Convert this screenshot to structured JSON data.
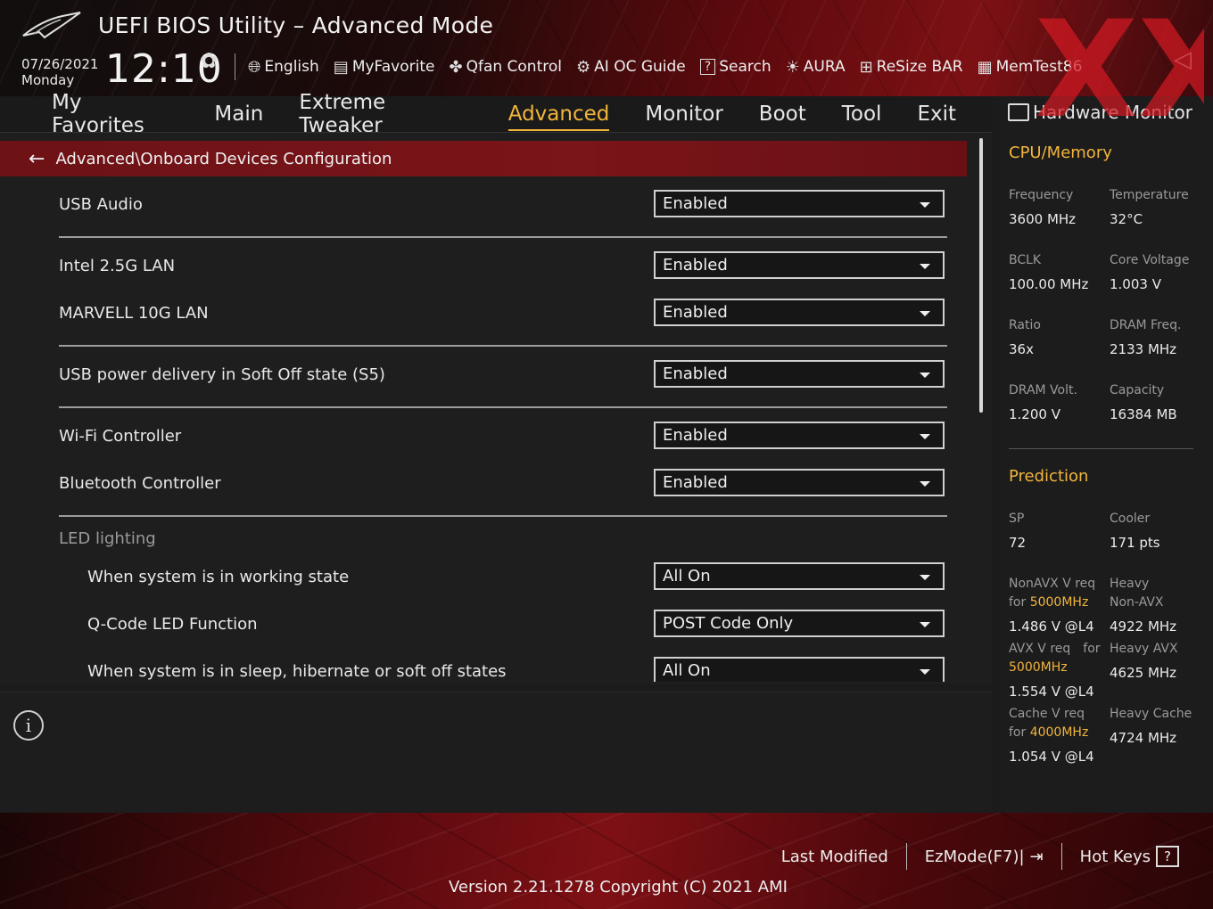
{
  "header": {
    "title": "UEFI BIOS Utility – Advanced Mode",
    "date": "07/26/2021",
    "day": "Monday",
    "time": "12:10",
    "brand_watermark": "XX",
    "tools": [
      {
        "icon": "globe-icon",
        "label": "English"
      },
      {
        "icon": "favorites-icon",
        "label": "MyFavorite"
      },
      {
        "icon": "fan-icon",
        "label": "Qfan Control"
      },
      {
        "icon": "ai-chip-icon",
        "label": "AI OC Guide"
      },
      {
        "icon": "question-box-icon",
        "label": "Search"
      },
      {
        "icon": "aura-light-icon",
        "label": "AURA"
      },
      {
        "icon": "resize-bar-icon",
        "label": "ReSize BAR"
      },
      {
        "icon": "memory-icon",
        "label": "MemTest86"
      }
    ]
  },
  "nav": {
    "tabs": [
      {
        "label": "My Favorites",
        "active": false
      },
      {
        "label": "Main",
        "active": false
      },
      {
        "label": "Extreme Tweaker",
        "active": false
      },
      {
        "label": "Advanced",
        "active": true
      },
      {
        "label": "Monitor",
        "active": false
      },
      {
        "label": "Boot",
        "active": false
      },
      {
        "label": "Tool",
        "active": false
      },
      {
        "label": "Exit",
        "active": false
      }
    ]
  },
  "main": {
    "breadcrumb": "Advanced\\Onboard Devices Configuration",
    "settings": [
      {
        "label": "USB Audio",
        "value": "Enabled"
      },
      {
        "label": "Intel 2.5G LAN",
        "value": "Enabled"
      },
      {
        "label": "MARVELL 10G LAN",
        "value": "Enabled"
      },
      {
        "label": "USB power delivery in Soft Off state (S5)",
        "value": "Enabled"
      },
      {
        "label": "Wi-Fi Controller",
        "value": "Enabled"
      },
      {
        "label": "Bluetooth Controller",
        "value": "Enabled"
      },
      {
        "label": "LED lighting"
      },
      {
        "label": "When system is in working state",
        "value": "All On"
      },
      {
        "label": "Q-Code LED Function",
        "value": "POST Code Only"
      },
      {
        "label": "When system is in sleep, hibernate or soft off states",
        "value": "All On"
      }
    ]
  },
  "hw_monitor": {
    "title": "Hardware Monitor",
    "cpu_memory": {
      "heading": "CPU/Memory",
      "frequency_label": "Frequency",
      "frequency": "3600 MHz",
      "temperature_label": "Temperature",
      "temperature": "32°C",
      "bclk_label": "BCLK",
      "bclk": "100.00 MHz",
      "core_voltage_label": "Core Voltage",
      "core_voltage": "1.003 V",
      "ratio_label": "Ratio",
      "ratio": "36x",
      "dram_freq_label": "DRAM Freq.",
      "dram_freq": "2133 MHz",
      "dram_volt_label": "DRAM Volt.",
      "dram_volt": "1.200 V",
      "capacity_label": "Capacity",
      "capacity": "16384 MB"
    },
    "prediction": {
      "heading": "Prediction",
      "sp_label": "SP",
      "sp": "72",
      "cooler_label": "Cooler",
      "cooler": "171 pts",
      "nonavx_label_1": "NonAVX V req",
      "nonavx_label_for": "for ",
      "nonavx_freq": "5000MHz",
      "nonavx_v": "1.486 V @L4",
      "heavy_nonavx_label_1": "Heavy",
      "heavy_nonavx_label_2": "Non-AVX",
      "heavy_nonavx": "4922 MHz",
      "avx_label_1": "AVX V req",
      "avx_label_for": "for",
      "avx_freq": "5000MHz",
      "avx_v": "1.554 V @L4",
      "heavy_avx_label": "Heavy AVX",
      "heavy_avx": "4625 MHz",
      "cache_label_1": "Cache V req",
      "cache_label_for": "for ",
      "cache_freq": "4000MHz",
      "cache_v": "1.054 V @L4",
      "heavy_cache_label": "Heavy Cache",
      "heavy_cache": "4724 MHz"
    }
  },
  "footer": {
    "last_modified": "Last Modified",
    "ezmode": "EzMode(F7)|",
    "hotkeys": "Hot Keys",
    "hotkeys_box": "?",
    "version": "Version 2.21.1278 Copyright (C) 2021 AMI"
  },
  "colors": {
    "accent": "#f2b53c",
    "breadcrumb_bg": "#7a1519",
    "brand_red": "#d21923"
  }
}
